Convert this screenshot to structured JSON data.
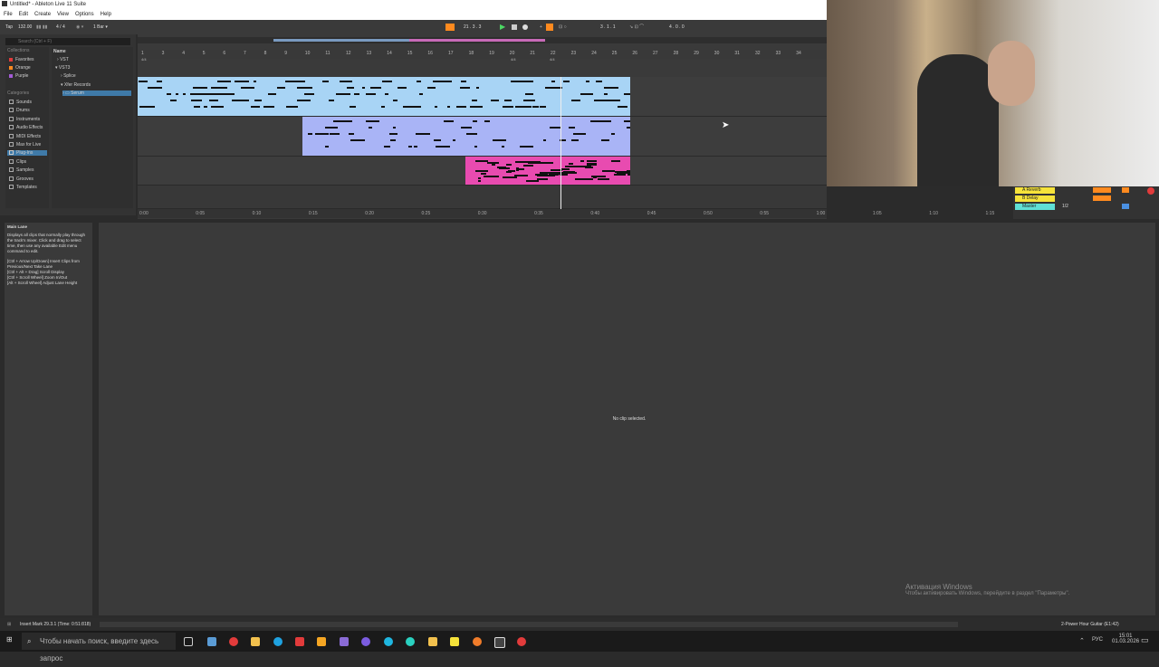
{
  "window": {
    "title": "Untitled* - Ableton Live 11 Suite",
    "menu": [
      "File",
      "Edit",
      "Create",
      "View",
      "Options",
      "Help"
    ]
  },
  "control": {
    "tap": "Tap",
    "bpm": "132.00",
    "meter": "4 / 4",
    "quantize": "1 Bar ▾",
    "position": "21 . 3 . 3",
    "loop_start": "3 . 1 . 1",
    "loop_len": "4 . 0 . 0"
  },
  "browser": {
    "search_placeholder": "Search (Ctrl + F)",
    "collections_label": "Collections",
    "collections": [
      {
        "label": "Favorites",
        "color": "#e23b3b"
      },
      {
        "label": "Orange",
        "color": "#ff8a1f"
      },
      {
        "label": "Purple",
        "color": "#a35bd6"
      }
    ],
    "categories_label": "Categories",
    "categories": [
      "Sounds",
      "Drums",
      "Instruments",
      "Audio Effects",
      "MIDI Effects",
      "Max for Live",
      "Plug-Ins",
      "Clips",
      "Samples",
      "Grooves",
      "Templates"
    ],
    "name_header": "Name",
    "tree": [
      "VST",
      "VST3",
      "Splice",
      "Xfer Records",
      "Serum"
    ]
  },
  "ruler": {
    "bars": [
      "1",
      "3",
      "4",
      "5",
      "6",
      "7",
      "8",
      "9",
      "10",
      "11",
      "12",
      "13",
      "14",
      "15",
      "16",
      "17",
      "18",
      "19",
      "20",
      "21",
      "22",
      "23",
      "24",
      "25",
      "26",
      "27",
      "28",
      "29",
      "30",
      "31",
      "32",
      "33",
      "34"
    ],
    "times": [
      "0:00",
      "0:05",
      "0:10",
      "0:15",
      "0:20",
      "0:25",
      "0:30",
      "0:35",
      "0:40",
      "0:45",
      "0:50",
      "0:55",
      "1:00",
      "1:05",
      "1:10",
      "1:15"
    ],
    "sig1": "4/4",
    "sig2": "4/4",
    "sig3": "4/4"
  },
  "mixer": {
    "return_a": "A Reverb",
    "return_b": "B Delay",
    "master": "Master",
    "cue": "1/2"
  },
  "info": {
    "title": "Main Lane",
    "lines": [
      "Displays all clips that normally play through the track's mixer. Click and drag to select time, then use any available Edit menu command to edit.",
      "",
      "[Ctrl + Arrow Up/Down] Insert Clips from Previous/Next Take Lane",
      "[Ctrl + Alt + Drag] Scroll Display",
      "[Ctrl + Scroll Wheel] Zoom In/Out",
      "[Alt + Scroll Wheel] Adjust Lane Height"
    ]
  },
  "detail": {
    "empty": "No clip selected."
  },
  "status": {
    "left": "Insert Mark 29.3.1 (Time: 0:51:818)",
    "right": "2-Power Hour Guitar (E1:42)"
  },
  "taskbar": {
    "search": "Чтобы начать поиск, введите здесь запрос",
    "lang": "РУС",
    "time": "15:01",
    "date": "01.03.2026"
  },
  "watermark": {
    "title": "Активация Windows",
    "sub": "Чтобы активировать Windows, перейдите в раздел \"Параметры\"."
  },
  "colors": {
    "clip1": "#a8d4f5",
    "clip2": "#a9b4f6",
    "clip3": "#e84bb0",
    "accent": "#ff8a1f"
  }
}
